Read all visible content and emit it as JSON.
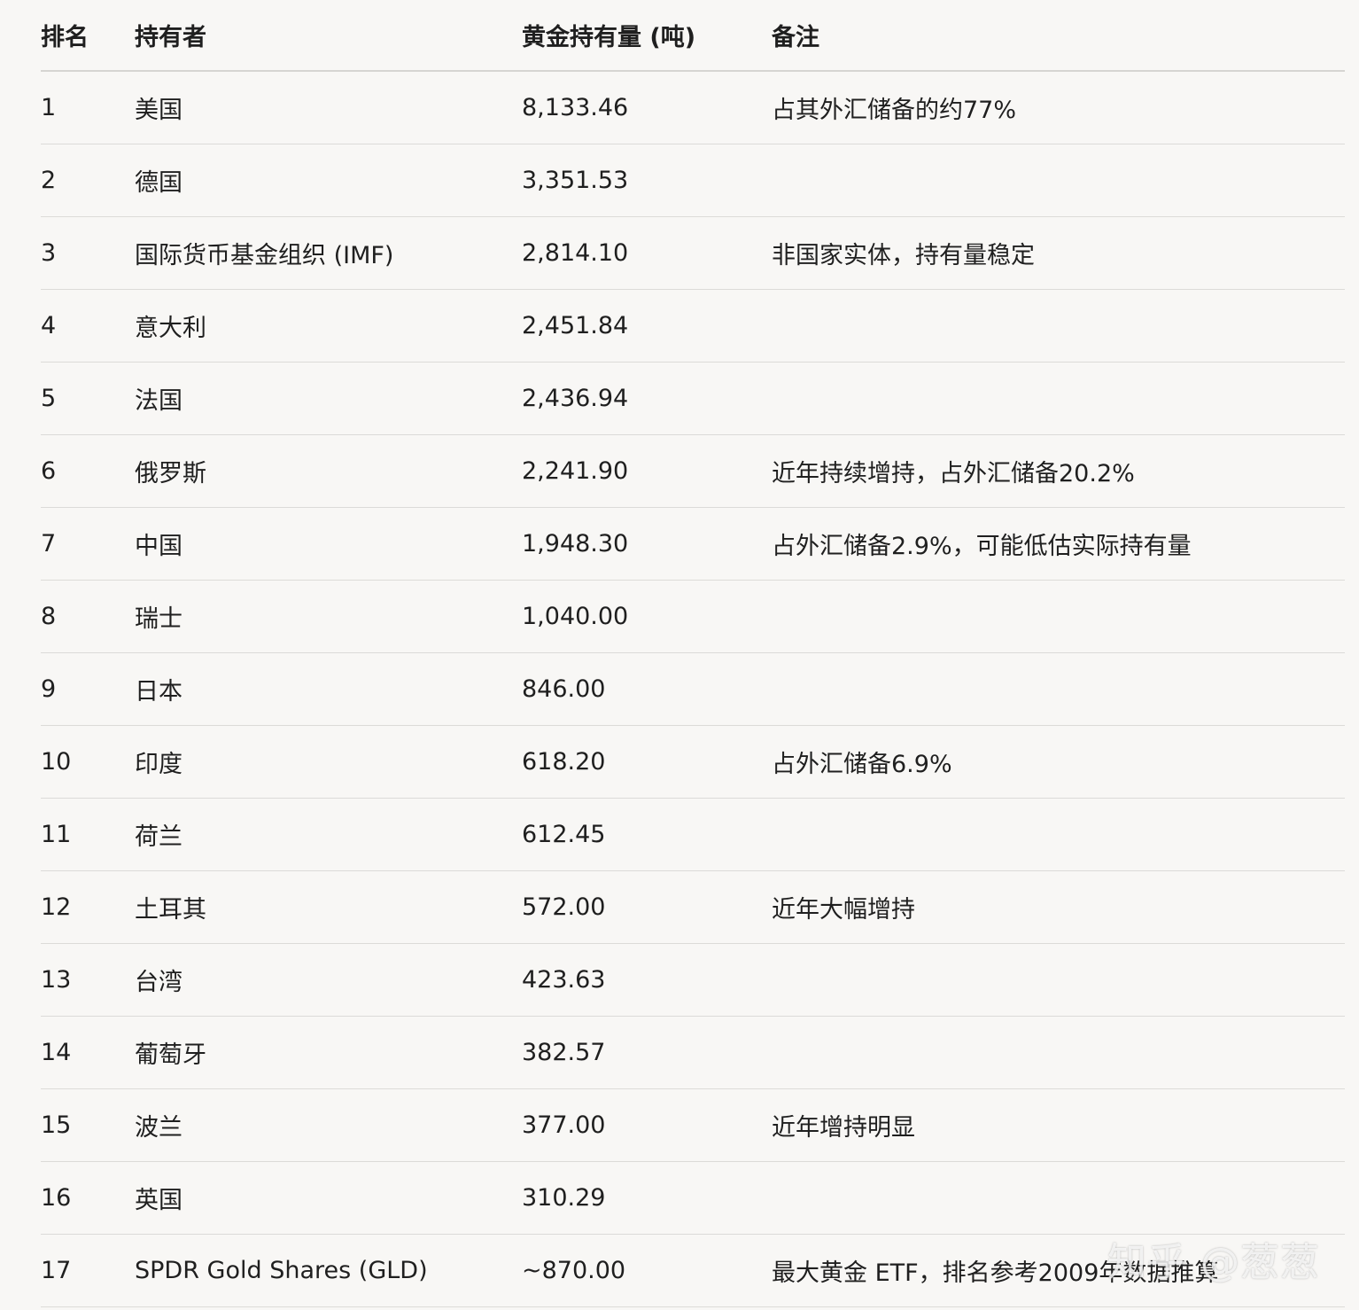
{
  "table": {
    "headers": {
      "rank": "排名",
      "holder": "持有者",
      "amount": "黄金持有量 (吨)",
      "note": "备注"
    },
    "rows": [
      {
        "rank": "1",
        "holder": "美国",
        "amount": "8,133.46",
        "note": "占其外汇储备的约77%"
      },
      {
        "rank": "2",
        "holder": "德国",
        "amount": "3,351.53",
        "note": ""
      },
      {
        "rank": "3",
        "holder": "国际货币基金组织 (IMF)",
        "amount": "2,814.10",
        "note": "非国家实体，持有量稳定"
      },
      {
        "rank": "4",
        "holder": "意大利",
        "amount": "2,451.84",
        "note": ""
      },
      {
        "rank": "5",
        "holder": "法国",
        "amount": "2,436.94",
        "note": ""
      },
      {
        "rank": "6",
        "holder": "俄罗斯",
        "amount": "2,241.90",
        "note": "近年持续增持，占外汇储备20.2%"
      },
      {
        "rank": "7",
        "holder": "中国",
        "amount": "1,948.30",
        "note": "占外汇储备2.9%，可能低估实际持有量"
      },
      {
        "rank": "8",
        "holder": "瑞士",
        "amount": "1,040.00",
        "note": ""
      },
      {
        "rank": "9",
        "holder": "日本",
        "amount": "846.00",
        "note": ""
      },
      {
        "rank": "10",
        "holder": "印度",
        "amount": "618.20",
        "note": "占外汇储备6.9%"
      },
      {
        "rank": "11",
        "holder": "荷兰",
        "amount": "612.45",
        "note": ""
      },
      {
        "rank": "12",
        "holder": "土耳其",
        "amount": "572.00",
        "note": "近年大幅增持"
      },
      {
        "rank": "13",
        "holder": "台湾",
        "amount": "423.63",
        "note": ""
      },
      {
        "rank": "14",
        "holder": "葡萄牙",
        "amount": "382.57",
        "note": ""
      },
      {
        "rank": "15",
        "holder": "波兰",
        "amount": "377.00",
        "note": "近年增持明显"
      },
      {
        "rank": "16",
        "holder": "英国",
        "amount": "310.29",
        "note": ""
      },
      {
        "rank": "17",
        "holder": "SPDR Gold Shares (GLD)",
        "amount": "~870.00",
        "note": "最大黄金 ETF，排名参考2009年数据推算"
      }
    ]
  },
  "watermark": "知乎 @葱葱"
}
